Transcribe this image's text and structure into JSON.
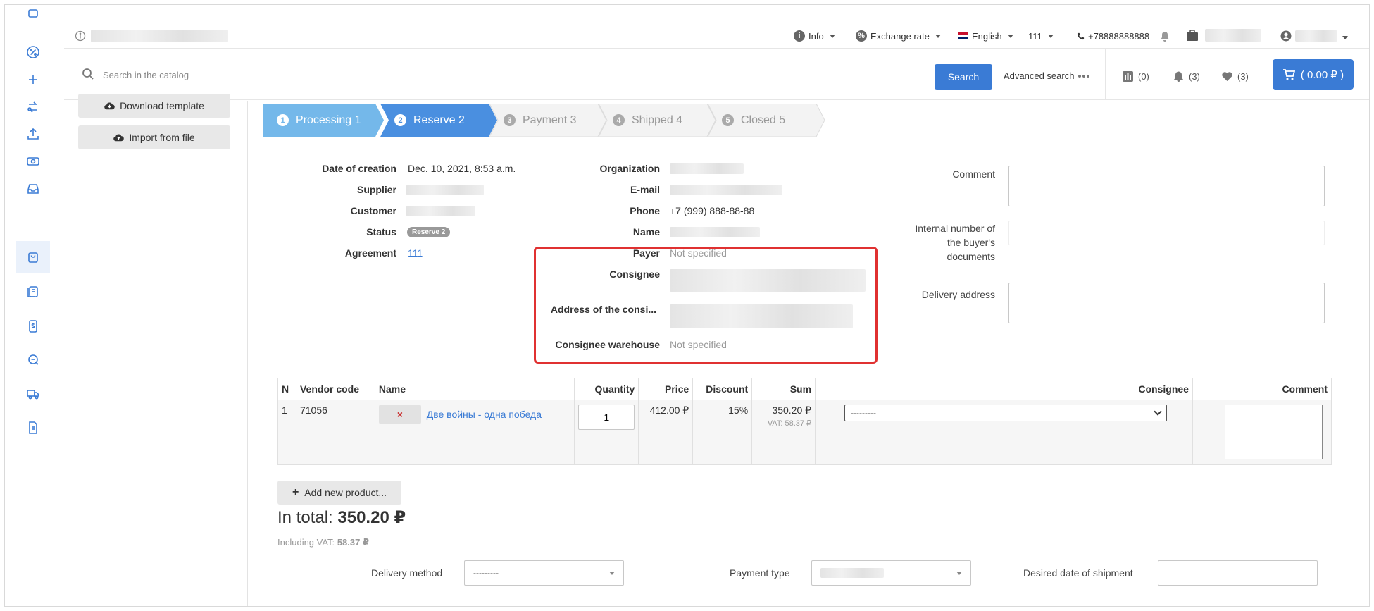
{
  "topbar": {
    "info_label": "Info",
    "exchange_label": "Exchange rate",
    "language_label": "English",
    "agreement_label": "111",
    "phone": "+78888888888"
  },
  "search": {
    "placeholder": "Search in the catalog",
    "button_label": "Search",
    "advanced_label": "Advanced search",
    "compare_count": "(0)",
    "notifications_count": "(3)",
    "favorites_count": "(3)",
    "cart_total": "( 0.00 ₽ )"
  },
  "leftpanel": {
    "download_label": "Download template",
    "import_label": "Import from file"
  },
  "steps": [
    {
      "num": "1",
      "label": "Processing 1"
    },
    {
      "num": "2",
      "label": "Reserve 2"
    },
    {
      "num": "3",
      "label": "Payment 3"
    },
    {
      "num": "4",
      "label": "Shipped 4"
    },
    {
      "num": "5",
      "label": "Closed 5"
    }
  ],
  "order": {
    "date_label": "Date of creation",
    "date_value": "Dec. 10, 2021, 8:53 a.m.",
    "supplier_label": "Supplier",
    "customer_label": "Customer",
    "status_label": "Status",
    "status_value": "Reserve 2",
    "agreement_label": "Agreement",
    "agreement_value": "111",
    "organization_label": "Organization",
    "email_label": "E-mail",
    "phone_label": "Phone",
    "phone_value": "+7 (999) 888-88-88",
    "name_label": "Name",
    "payer_label": "Payer",
    "payer_value": "Not specified",
    "consignee_label": "Consignee",
    "consignee_address_label": "Address of the consi...",
    "consignee_warehouse_label": "Consignee warehouse",
    "consignee_warehouse_value": "Not specified",
    "comment_label": "Comment",
    "internal_number_label_1": "Internal number of",
    "internal_number_label_2": "the buyer's",
    "internal_number_label_3": "documents",
    "delivery_address_label": "Delivery address"
  },
  "table": {
    "headers": {
      "n": "N",
      "vendor_code": "Vendor code",
      "name": "Name",
      "quantity": "Quantity",
      "price": "Price",
      "discount": "Discount",
      "sum": "Sum",
      "consignee": "Consignee",
      "comment": "Comment"
    },
    "rows": [
      {
        "n": "1",
        "vendor_code": "71056",
        "delete_glyph": "×",
        "name": "Две войны - одна победа",
        "quantity": "1",
        "price": "412.00 ₽",
        "discount": "15%",
        "sum": "350.20 ₽",
        "vat": "VAT: 58.37 ₽",
        "consignee": "---------"
      }
    ]
  },
  "totals": {
    "add_product_label": "Add new product...",
    "total_prefix": "In total:",
    "total_value": "350.20 ₽",
    "vat_prefix": "Including VAT:",
    "vat_value": "58.37 ₽"
  },
  "bottom": {
    "delivery_method_label": "Delivery method",
    "delivery_method_value": "---------",
    "payment_type_label": "Payment type",
    "desired_date_label": "Desired date of shipment"
  },
  "colors": {
    "accent": "#3a7bd5",
    "step_done": "#74b8ea",
    "step_current": "#4a8fe0",
    "highlight_box": "#e03131"
  }
}
